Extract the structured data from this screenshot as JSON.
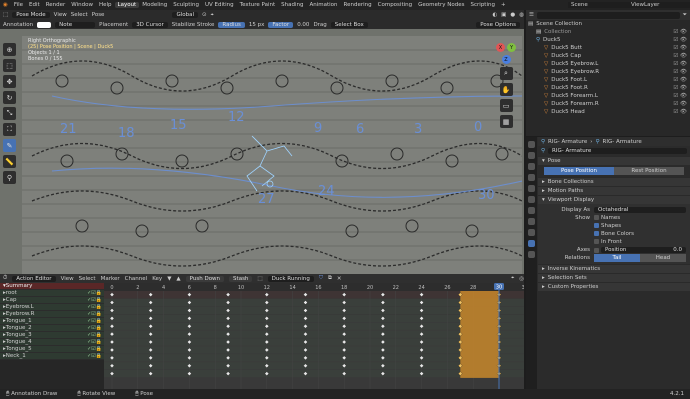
{
  "topbar": {
    "menus": [
      "File",
      "Edit",
      "Render",
      "Window",
      "Help"
    ],
    "workspaces": [
      "Layout",
      "Modeling",
      "Sculpting",
      "UV Editing",
      "Texture Paint",
      "Shading",
      "Animation",
      "Rendering",
      "Compositing",
      "Geometry Nodes",
      "Scripting"
    ],
    "active_workspace": "Layout",
    "scene": "Scene",
    "view_layer": "ViewLayer"
  },
  "viewport": {
    "mode": "Pose Mode",
    "menus": [
      "View",
      "Select",
      "Pose"
    ],
    "orientation": "Global",
    "annotation_label": "Annotation",
    "note_label": "Note",
    "placement_label": "Placement",
    "cursor_label": "3D Cursor",
    "stabilize_label": "Stabilize Stroke",
    "radius_label": "Radius",
    "radius_value": "15 px",
    "factor_label": "Factor",
    "factor_value": "0.00",
    "drag_label": "Drag",
    "select_box": "Select Box",
    "pose_options": "Pose Options",
    "info_lines": [
      "Right Orthographic",
      "(25) Pose Position | Scene | Duck5",
      "Objects    1 / 1",
      "Bones      0 / 155"
    ],
    "frame_numbers": [
      "21",
      "18",
      "15",
      "12",
      "9",
      "6",
      "3",
      "0",
      "27",
      "24",
      "30"
    ],
    "toolbar_icons": [
      "cursor-icon",
      "select-icon",
      "move-icon",
      "rotate-icon",
      "scale-icon",
      "transform-icon",
      "annotate-icon",
      "measure-icon",
      "pose-relax-icon"
    ]
  },
  "outliner": {
    "items": [
      {
        "label": "Scene Collection",
        "indent": 0,
        "type": "collection"
      },
      {
        "label": "Collection",
        "indent": 1,
        "type": "collection"
      },
      {
        "label": "Duck5",
        "indent": 1,
        "type": "armature"
      },
      {
        "label": "Duck5 Butt",
        "indent": 2,
        "type": "bone"
      },
      {
        "label": "Duck5 Cap",
        "indent": 2,
        "type": "bone"
      },
      {
        "label": "Duck5 Eyebrow.L",
        "indent": 2,
        "type": "bone"
      },
      {
        "label": "Duck5 Eyebrow.R",
        "indent": 2,
        "type": "bone"
      },
      {
        "label": "Duck5 Foot.L",
        "indent": 2,
        "type": "bone"
      },
      {
        "label": "Duck5 Foot.R",
        "indent": 2,
        "type": "bone"
      },
      {
        "label": "Duck5 Forearm.L",
        "indent": 2,
        "type": "bone"
      },
      {
        "label": "Duck5 Forearm.R",
        "indent": 2,
        "type": "bone"
      },
      {
        "label": "Duck5 Head",
        "indent": 2,
        "type": "bone"
      }
    ]
  },
  "properties": {
    "breadcrumb_left": "RIG- Armature",
    "breadcrumb_right": "RIG- Armature",
    "name_field": "RIG- Armature",
    "pose_panel": "Pose",
    "pose_position": "Pose Position",
    "rest_position": "Rest Position",
    "panels_collapsed": [
      "Bone Collections",
      "Motion Paths"
    ],
    "viewport_display": "Viewport Display",
    "display_as_label": "Display As",
    "display_as_value": "Octahedral",
    "show_label": "Show",
    "show_items": [
      "Names",
      "Shapes",
      "Bone Colors",
      "In Front"
    ],
    "show_checked": [
      false,
      true,
      true,
      false
    ],
    "axes_label": "Axes",
    "position_label": "Position",
    "position_value": "0.0",
    "relations_label": "Relations",
    "tail": "Tail",
    "head": "Head",
    "panels_after": [
      "Inverse Kinematics",
      "Selection Sets",
      "Custom Properties"
    ]
  },
  "dopesheet": {
    "editor": "Action Editor",
    "menus": [
      "View",
      "Select",
      "Marker",
      "Channel",
      "Key"
    ],
    "push_down": "Push Down",
    "stash": "Stash",
    "action_name": "Duck Running",
    "channels": [
      "Summary",
      "root",
      "Cap",
      "Eyebrow.L",
      "Eyebrow.R",
      "Tongue_1",
      "Tongue_2",
      "Tongue_3",
      "Tongue_4",
      "Tongue_5",
      "Neck_1"
    ],
    "ruler_labels": [
      "0",
      "2",
      "4",
      "6",
      "8",
      "10",
      "12",
      "14",
      "16",
      "18",
      "20",
      "22",
      "24",
      "26",
      "28",
      "30",
      "32"
    ],
    "current_frame": "30",
    "key_frames": [
      0,
      3,
      6,
      9,
      12,
      15,
      18,
      21,
      24,
      27,
      30
    ]
  },
  "status": {
    "left": "Annotation Draw",
    "middle": "Rotate View",
    "right": "Pose",
    "version": "4.2.1"
  },
  "colors": {
    "accent": "#4772b3",
    "bone": "#e08a3a",
    "blue_marks": "#6a8fd6",
    "keyframe_fill": "#c8872c"
  }
}
